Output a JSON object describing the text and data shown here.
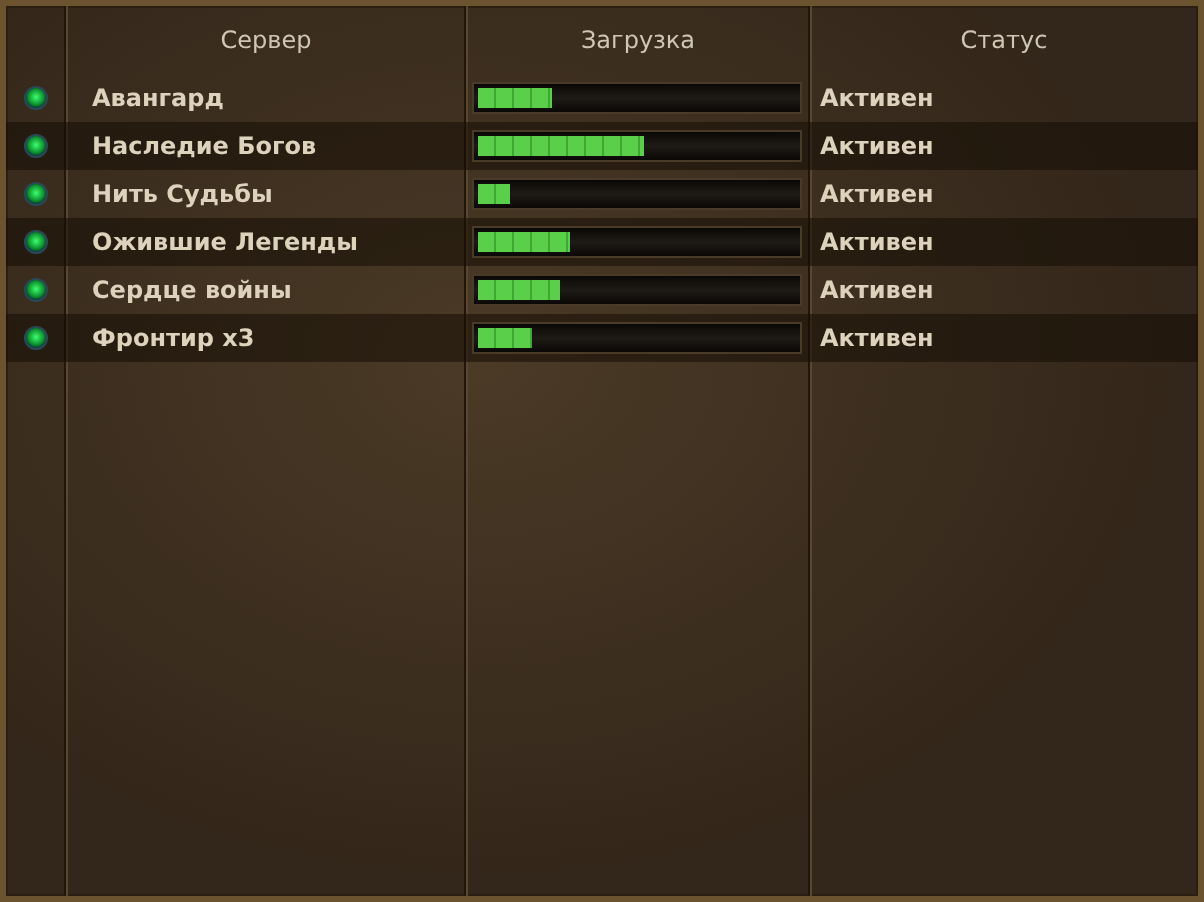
{
  "columns": [
    "Сервер",
    "Загрузка",
    "Статус"
  ],
  "servers": [
    {
      "name": "Авангард",
      "level": 0.23,
      "status": "Активен"
    },
    {
      "name": "Наследие Богов",
      "level": 0.52,
      "status": "Активен"
    },
    {
      "name": "Нить Судьбы",
      "level": 0.1,
      "status": "Активен"
    },
    {
      "name": "Ожившие Легенды",
      "level": 0.29,
      "status": "Активен"
    },
    {
      "name": "Сердце войны",
      "level": 0.26,
      "status": "Активен"
    },
    {
      "name": "Фронтир x3",
      "level": 0.17,
      "status": "Активен"
    }
  ]
}
